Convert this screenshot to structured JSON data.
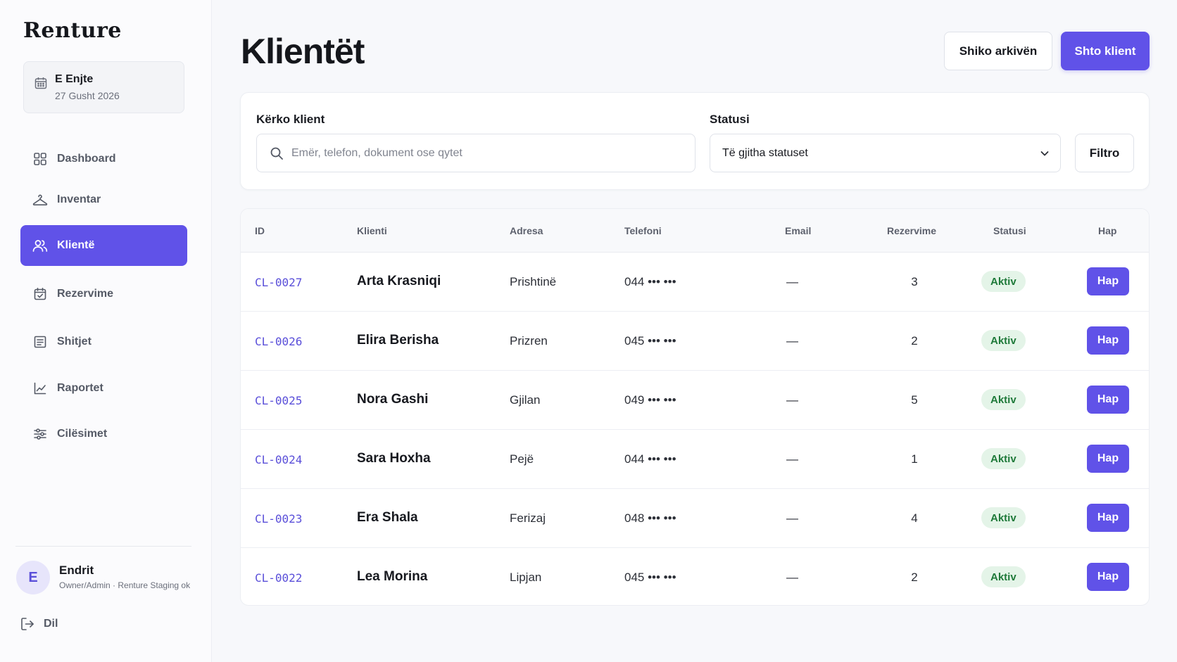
{
  "app": {
    "brand": "Renture"
  },
  "date": {
    "day": "E Enjte",
    "full": "27 Gusht 2026"
  },
  "sidebar": {
    "items": [
      {
        "label": "Dashboard",
        "icon": "grid-icon"
      },
      {
        "label": "Inventar",
        "icon": "hanger-icon"
      },
      {
        "label": "Klientë",
        "icon": "users-icon",
        "active": true
      },
      {
        "label": "Rezervime",
        "icon": "calendar-check-icon"
      },
      {
        "label": "Shitjet",
        "icon": "receipt-icon"
      },
      {
        "label": "Raportet",
        "icon": "chart-icon"
      },
      {
        "label": "Cilësimet",
        "icon": "sliders-icon"
      }
    ]
  },
  "user": {
    "initial": "E",
    "name": "Endrit",
    "role": "Owner/Admin · Renture Staging ok",
    "logout_label": "Dil"
  },
  "page": {
    "title": "Klientët",
    "archive_label": "Shiko arkivën",
    "add_label": "Shto klient"
  },
  "filters": {
    "search_label": "Kërko klient",
    "search_placeholder": "Emër, telefon, dokument ose qytet",
    "status_label": "Statusi",
    "status_value": "Të gjitha statuset",
    "filter_button": "Filtro"
  },
  "table": {
    "columns": [
      "ID",
      "Klienti",
      "Adresa",
      "Telefoni",
      "Email",
      "Rezervime",
      "Statusi",
      "Hap"
    ],
    "rows": [
      {
        "id": "CL-0027",
        "name": "Arta Krasniqi",
        "address": "Prishtinë",
        "phone": "044 ••• •••",
        "email": "—",
        "bookings": "3",
        "status": "Aktiv",
        "action": "Hap"
      },
      {
        "id": "CL-0026",
        "name": "Elira Berisha",
        "address": "Prizren",
        "phone": "045 ••• •••",
        "email": "—",
        "bookings": "2",
        "status": "Aktiv",
        "action": "Hap"
      },
      {
        "id": "CL-0025",
        "name": "Nora Gashi",
        "address": "Gjilan",
        "phone": "049 ••• •••",
        "email": "—",
        "bookings": "5",
        "status": "Aktiv",
        "action": "Hap"
      },
      {
        "id": "CL-0024",
        "name": "Sara Hoxha",
        "address": "Pejë",
        "phone": "044 ••• •••",
        "email": "—",
        "bookings": "1",
        "status": "Aktiv",
        "action": "Hap"
      },
      {
        "id": "CL-0023",
        "name": "Era Shala",
        "address": "Ferizaj",
        "phone": "048 ••• •••",
        "email": "—",
        "bookings": "4",
        "status": "Aktiv",
        "action": "Hap"
      },
      {
        "id": "CL-0022",
        "name": "Lea Morina",
        "address": "Lipjan",
        "phone": "045 ••• •••",
        "email": "—",
        "bookings": "2",
        "status": "Aktiv",
        "action": "Hap"
      }
    ]
  },
  "colors": {
    "accent": "#6052e8",
    "badge_bg": "#e4f4e8",
    "badge_text": "#1f7a3a"
  }
}
